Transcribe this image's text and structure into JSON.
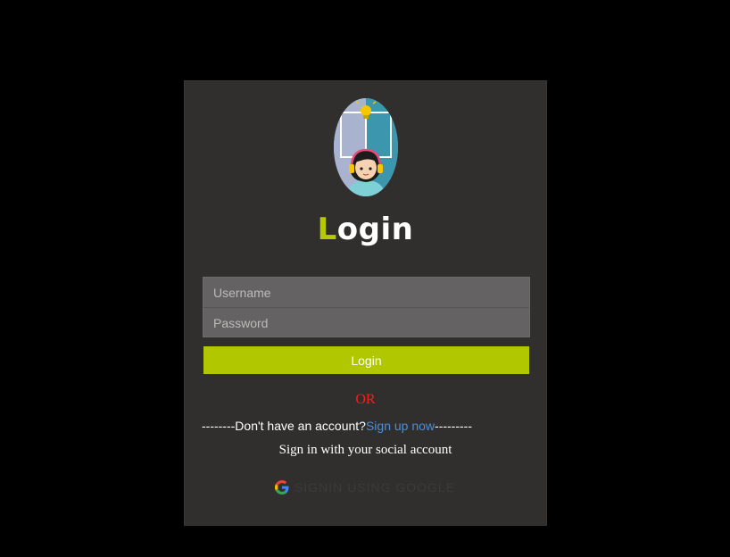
{
  "login": {
    "title_first": "L",
    "title_rest": "ogin",
    "username_placeholder": "Username",
    "password_placeholder": "Password",
    "submit_label": "Login",
    "or_label": "OR",
    "signup_prefix": "--------Don't have an account?",
    "signup_link": "Sign up now",
    "signup_suffix": "---------",
    "social_text": "Sign in with your social account",
    "google_label": "SIGNIN USING GOOGLE"
  },
  "colors": {
    "page_background": "#000000",
    "card_background": "#312f2e",
    "accent": "#b1c800",
    "input_background": "#646262",
    "or_text": "#ff1a1a",
    "link": "#4a8fd8"
  },
  "icons": {
    "avatar": "support-agent-avatar",
    "google": "google-g-icon"
  }
}
